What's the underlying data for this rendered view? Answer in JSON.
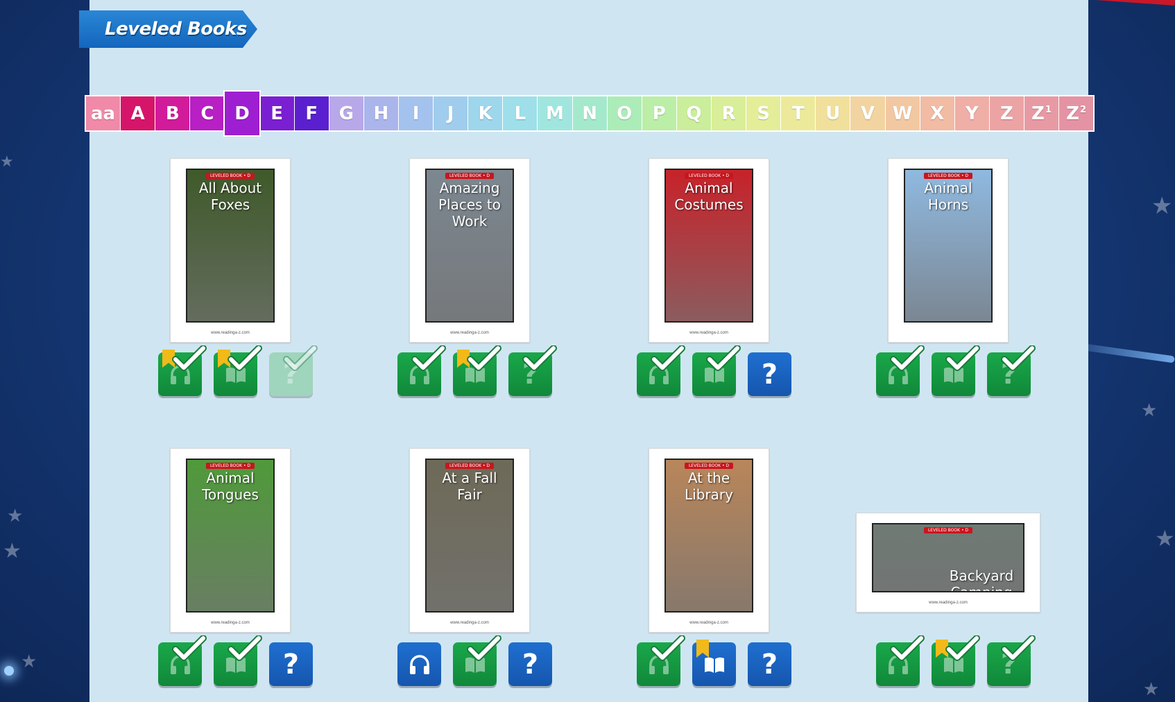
{
  "banner": {
    "title": "Leveled Books"
  },
  "levels": [
    {
      "label": "aa",
      "sup": "",
      "color": "#f08aa8"
    },
    {
      "label": "A",
      "sup": "",
      "color": "#d6156a"
    },
    {
      "label": "B",
      "sup": "",
      "color": "#d11b9a"
    },
    {
      "label": "C",
      "sup": "",
      "color": "#b81fc4"
    },
    {
      "label": "D",
      "sup": "",
      "color": "#9e1fd1",
      "selected": true
    },
    {
      "label": "E",
      "sup": "",
      "color": "#7a1fd1"
    },
    {
      "label": "F",
      "sup": "",
      "color": "#5a1fcf"
    },
    {
      "label": "G",
      "sup": "",
      "color": "#b8a8ea"
    },
    {
      "label": "H",
      "sup": "",
      "color": "#aab5ec"
    },
    {
      "label": "I",
      "sup": "",
      "color": "#a4c2ee"
    },
    {
      "label": "J",
      "sup": "",
      "color": "#a0cdee"
    },
    {
      "label": "K",
      "sup": "",
      "color": "#9ed6ec"
    },
    {
      "label": "L",
      "sup": "",
      "color": "#9edfea"
    },
    {
      "label": "M",
      "sup": "",
      "color": "#a0e6df"
    },
    {
      "label": "N",
      "sup": "",
      "color": "#a4e9cc"
    },
    {
      "label": "O",
      "sup": "",
      "color": "#acecb8"
    },
    {
      "label": "P",
      "sup": "",
      "color": "#bbeea7"
    },
    {
      "label": "Q",
      "sup": "",
      "color": "#caee9c"
    },
    {
      "label": "R",
      "sup": "",
      "color": "#d9ee98"
    },
    {
      "label": "S",
      "sup": "",
      "color": "#e4ee98"
    },
    {
      "label": "T",
      "sup": "",
      "color": "#ecea9a"
    },
    {
      "label": "U",
      "sup": "",
      "color": "#f1e09c"
    },
    {
      "label": "V",
      "sup": "",
      "color": "#f2d4a0"
    },
    {
      "label": "W",
      "sup": "",
      "color": "#f2c8a2"
    },
    {
      "label": "X",
      "sup": "",
      "color": "#f1bba4"
    },
    {
      "label": "Y",
      "sup": "",
      "color": "#efaea6"
    },
    {
      "label": "Z",
      "sup": "",
      "color": "#eca3a4"
    },
    {
      "label": "Z",
      "sup": "1",
      "color": "#e89aa4"
    },
    {
      "label": "Z",
      "sup": "2",
      "color": "#e493a4"
    }
  ],
  "books": [
    {
      "title": "All About Foxes",
      "tag": "LEVELED BOOK • D",
      "footer": "www.readinga-z.com",
      "cover_bg": "#3f5a2a",
      "listen": {
        "state": "complete",
        "bookmark": true
      },
      "read": {
        "state": "complete",
        "bookmark": true
      },
      "quiz": {
        "state": "disabled"
      }
    },
    {
      "title": "Amazing Places to Work",
      "tag": "LEVELED BOOK • D",
      "footer": "www.readinga-z.com",
      "cover_bg": "#7c8790",
      "listen": {
        "state": "complete"
      },
      "read": {
        "state": "complete",
        "bookmark": true
      },
      "quiz": {
        "state": "complete"
      }
    },
    {
      "title": "Animal Costumes",
      "tag": "LEVELED BOOK • D",
      "footer": "www.readinga-z.com",
      "cover_bg": "#c8222a",
      "listen": {
        "state": "complete"
      },
      "read": {
        "state": "complete"
      },
      "quiz": {
        "state": "available"
      }
    },
    {
      "title": "Animal Horns",
      "tag": "LEVELED BOOK • D",
      "footer": "",
      "cover_bg": "#8fb9e0",
      "listen": {
        "state": "complete"
      },
      "read": {
        "state": "complete"
      },
      "quiz": {
        "state": "complete"
      }
    },
    {
      "title": "Animal Tongues",
      "tag": "LEVELED BOOK • D",
      "footer": "www.readinga-z.com",
      "cover_bg": "#4f9a3a",
      "listen": {
        "state": "complete"
      },
      "read": {
        "state": "complete"
      },
      "quiz": {
        "state": "available"
      }
    },
    {
      "title": "At a Fall Fair",
      "tag": "LEVELED BOOK • D",
      "footer": "www.readinga-z.com",
      "cover_bg": "#6e6a58",
      "listen": {
        "state": "available"
      },
      "read": {
        "state": "complete"
      },
      "quiz": {
        "state": "available"
      }
    },
    {
      "title": "At the Library",
      "tag": "LEVELED BOOK • D",
      "footer": "www.readinga-z.com",
      "cover_bg": "#b9865a",
      "listen": {
        "state": "complete"
      },
      "read": {
        "state": "available",
        "bookmark": true
      },
      "quiz": {
        "state": "available"
      }
    },
    {
      "title": "Backyard Camping",
      "tag": "LEVELED BOOK • D",
      "footer": "www.readinga-z.com",
      "cover_bg": "#6f7a74",
      "listen": {
        "state": "complete"
      },
      "read": {
        "state": "complete",
        "bookmark": true
      },
      "quiz": {
        "state": "complete"
      }
    }
  ]
}
